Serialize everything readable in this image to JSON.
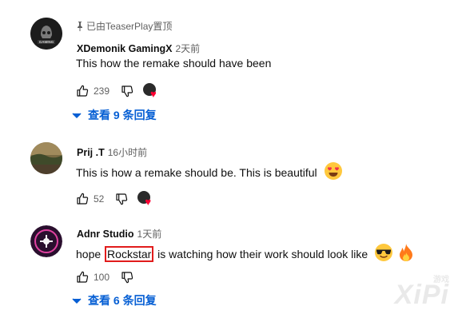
{
  "comments": [
    {
      "pinned_text": "已由TeaserPlay置顶",
      "avatar_text": "GAMING",
      "author": "XDemonik GamingX",
      "time": "2天前",
      "text": "This how the remake should have been",
      "likes": "239",
      "replies_label": "查看 9 条回复"
    },
    {
      "author": "Prij .T",
      "time": "16小时前",
      "text": "This is how a remake should be. This is beautiful",
      "likes": "52"
    },
    {
      "author": "Adnr Studio",
      "time": "1天前",
      "text_before": "hope ",
      "text_highlight": "Rockstar",
      "text_after": " is watching how their work should look like",
      "likes": "100",
      "replies_label": "查看 6 条回复"
    }
  ],
  "watermark": {
    "small": "游戏",
    "main": "XiPi"
  },
  "colors": {
    "link": "#065fd4",
    "heart": "#ff0033",
    "highlight_box": "#e11c1c"
  }
}
